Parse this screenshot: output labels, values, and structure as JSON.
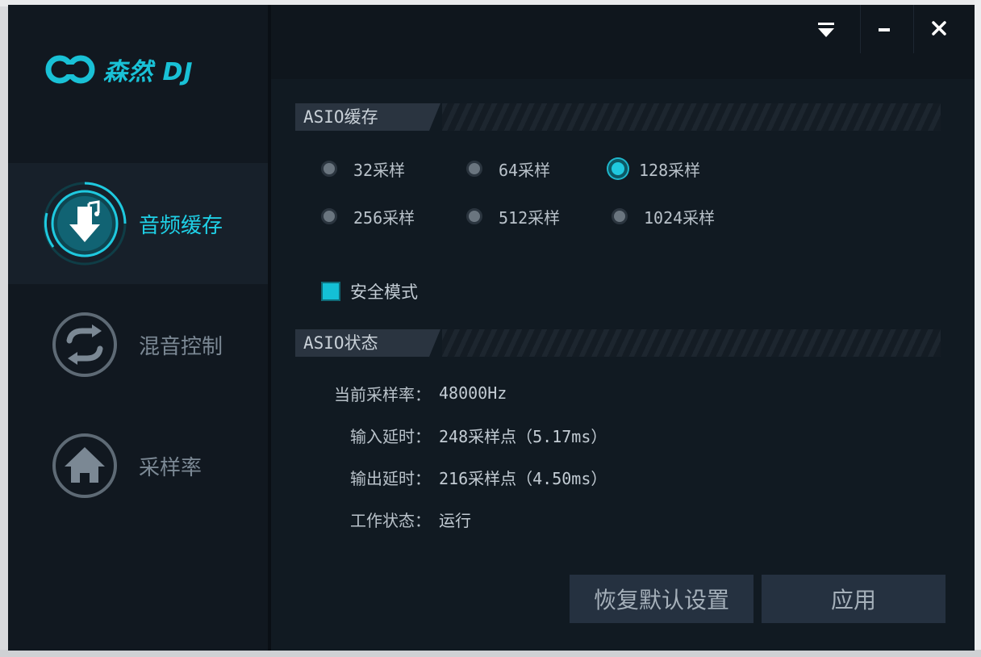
{
  "app": {
    "logo_text": "森然 DJ"
  },
  "colors": {
    "accent": "#1fc9df",
    "bg": "#0d141c"
  },
  "sidebar": {
    "items": [
      {
        "label": "音频缓存",
        "icon": "music-download-icon",
        "active": true
      },
      {
        "label": "混音控制",
        "icon": "swap-arrows-icon",
        "active": false
      },
      {
        "label": "采样率",
        "icon": "home-icon",
        "active": false
      }
    ]
  },
  "window_controls": {
    "menu": "menu-down-icon",
    "minimize": "minimize-icon",
    "close": "close-icon"
  },
  "asio_buffer": {
    "title": "ASIO缓存",
    "options": [
      "32采样",
      "64采样",
      "128采样",
      "256采样",
      "512采样",
      "1024采样"
    ],
    "selected": "128采样"
  },
  "safe_mode": {
    "label": "安全模式",
    "checked": true
  },
  "asio_status": {
    "title": "ASIO状态",
    "rows": [
      {
        "key": "当前采样率：",
        "value": "48000Hz"
      },
      {
        "key": "输入延时：",
        "value": "248采样点（5.17ms）"
      },
      {
        "key": "输出延时：",
        "value": "216采样点（4.50ms）"
      },
      {
        "key": "工作状态：",
        "value": "运行"
      }
    ]
  },
  "buttons": {
    "reset": "恢复默认设置",
    "apply": "应用"
  }
}
